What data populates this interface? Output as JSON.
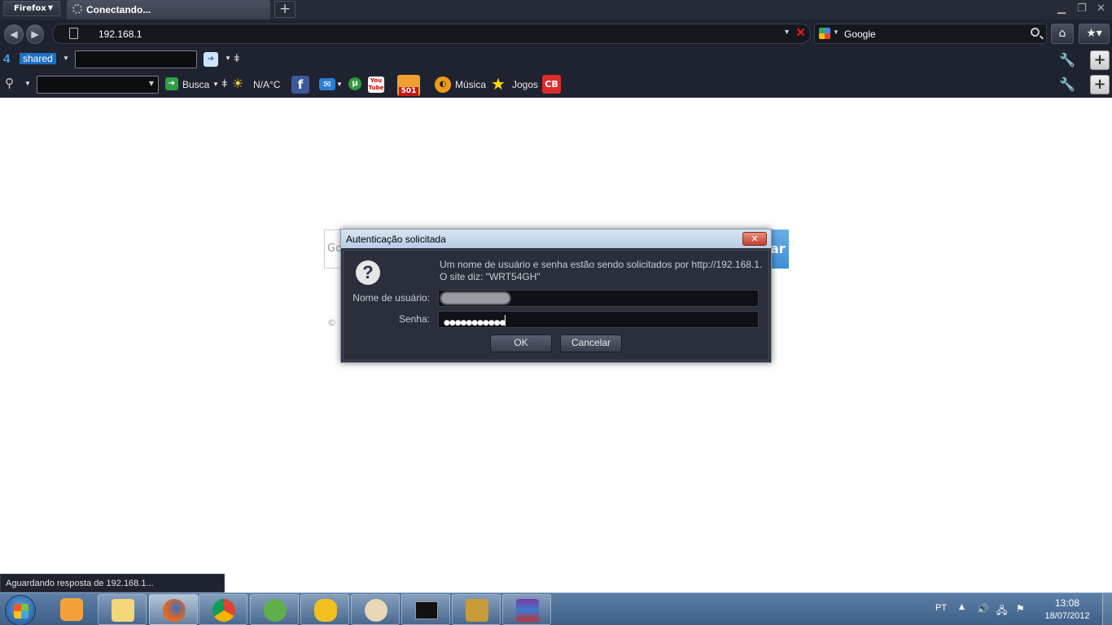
{
  "browser": {
    "app_button_label": "Firefox",
    "tab_title": "Conectando...",
    "new_tab_symbol": "+",
    "url": "192.168.1",
    "search_engine": "Google"
  },
  "toolbar_4shared": {
    "logo_text": "shared",
    "logo_number": "4"
  },
  "toolbar_2": {
    "busca_label": "Busca",
    "weather_label": "N/A°C",
    "email_count": "501",
    "music_label": "Música",
    "games_label": "Jogos",
    "cb_label": "CB",
    "youtube_label": "You Tube"
  },
  "page_background": {
    "search_button_fragment": "ar",
    "box_fragment": "Go",
    "copyright_fragment": "©"
  },
  "dialog": {
    "title": "Autenticação solicitada",
    "close_symbol": "✕",
    "message_line1": "Um nome de usuário e senha estão sendo solicitados por http://192.168.1.",
    "message_line2": "O site diz: \"WRT54GH\"",
    "username_label": "Nome de usuário:",
    "password_label": "Senha:",
    "password_value": "●●●●●●●●●●●",
    "ok_label": "OK",
    "cancel_label": "Cancelar"
  },
  "status_bar": {
    "text": "Aguardando resposta de 192.168.1..."
  },
  "taskbar": {
    "language": "PT",
    "time": "13:08",
    "date": "18/07/2012",
    "items": [
      "media-player",
      "file-explorer",
      "firefox",
      "chrome",
      "messenger",
      "ftp-client",
      "paint",
      "command-prompt",
      "game",
      "winrar"
    ],
    "active_item": "firefox"
  },
  "colors": {
    "chrome_bg": "#1f2330",
    "dialog_bg": "#2b2f3c",
    "taskbar": "#4a6d96",
    "stop": "#e02020"
  }
}
